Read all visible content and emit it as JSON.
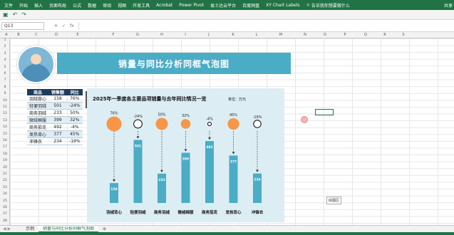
{
  "ribbon": {
    "tabs": [
      "文件",
      "开始",
      "插入",
      "页面布局",
      "公式",
      "数据",
      "审阅",
      "视图",
      "开发工具",
      "Acrobat",
      "Power Pivot",
      "易士达云平台",
      "百度网盘",
      "XY Chart Labels"
    ],
    "tell_me": "告诉我你想要做什么",
    "share": "共享"
  },
  "qat": {
    "save": "▣",
    "undo": "↶",
    "redo": "↷"
  },
  "formula_bar": {
    "name_box": "Q13",
    "cancel": "✕",
    "enter": "✓",
    "fx": "fx",
    "formula": ""
  },
  "columns": [
    "A",
    "B",
    "C",
    "D",
    "E",
    "F",
    "G",
    "H",
    "I",
    "J",
    "K",
    "L",
    "M",
    "N",
    "O",
    "P",
    "Q",
    "R",
    "S"
  ],
  "rows": [
    "1",
    "2",
    "3",
    "4",
    "5",
    "6",
    "7",
    "8",
    "9",
    "10",
    "11",
    "12",
    "13",
    "14",
    "15",
    "16",
    "17",
    "18",
    "19",
    "20",
    "21",
    "22",
    "23",
    "24",
    "25",
    "26",
    "27",
    "28"
  ],
  "banner": {
    "title": "销量与同比分析同框气泡图"
  },
  "table": {
    "headers": [
      "商品",
      "销售额",
      "同比"
    ],
    "rows": [
      [
        "羽绒背心",
        "158",
        "76%"
      ],
      [
        "轻便羽绒",
        "501",
        "-24%"
      ],
      [
        "商务羽绒",
        "233",
        "50%"
      ],
      [
        "微绒棉服",
        "399",
        "32%"
      ],
      [
        "商务茄克",
        "492",
        "-4%"
      ],
      [
        "发热背心",
        "377",
        "45%"
      ],
      [
        "冲锋衣",
        "234",
        "-19%"
      ]
    ]
  },
  "chart_data": {
    "type": "bar",
    "title": "2025年一季度各主要品项销量与去年同比情况一览",
    "unit_label": "单位：万元",
    "categories": [
      "羽绒背心",
      "轻便羽绒",
      "商务羽绒",
      "微绒棉服",
      "商务茄克",
      "发热背心",
      "冲锋衣"
    ],
    "values": [
      158,
      501,
      233,
      399,
      492,
      377,
      234
    ],
    "yoy_labels": [
      "76%",
      "-24%",
      "50%",
      "32%",
      "-4%",
      "45%",
      "-19%"
    ],
    "yoy": [
      0.76,
      -0.24,
      0.5,
      0.32,
      -0.04,
      0.45,
      -0.19
    ],
    "ylim": [
      0,
      600
    ],
    "colors": {
      "bar": "#4bacc6",
      "positive": "#f79646",
      "negative": "#ffffff",
      "background": "#dcedf3"
    }
  },
  "sheet_tabs": [
    "示例",
    "销量与同比分析同框气泡图"
  ],
  "tooltip": "绘图区"
}
